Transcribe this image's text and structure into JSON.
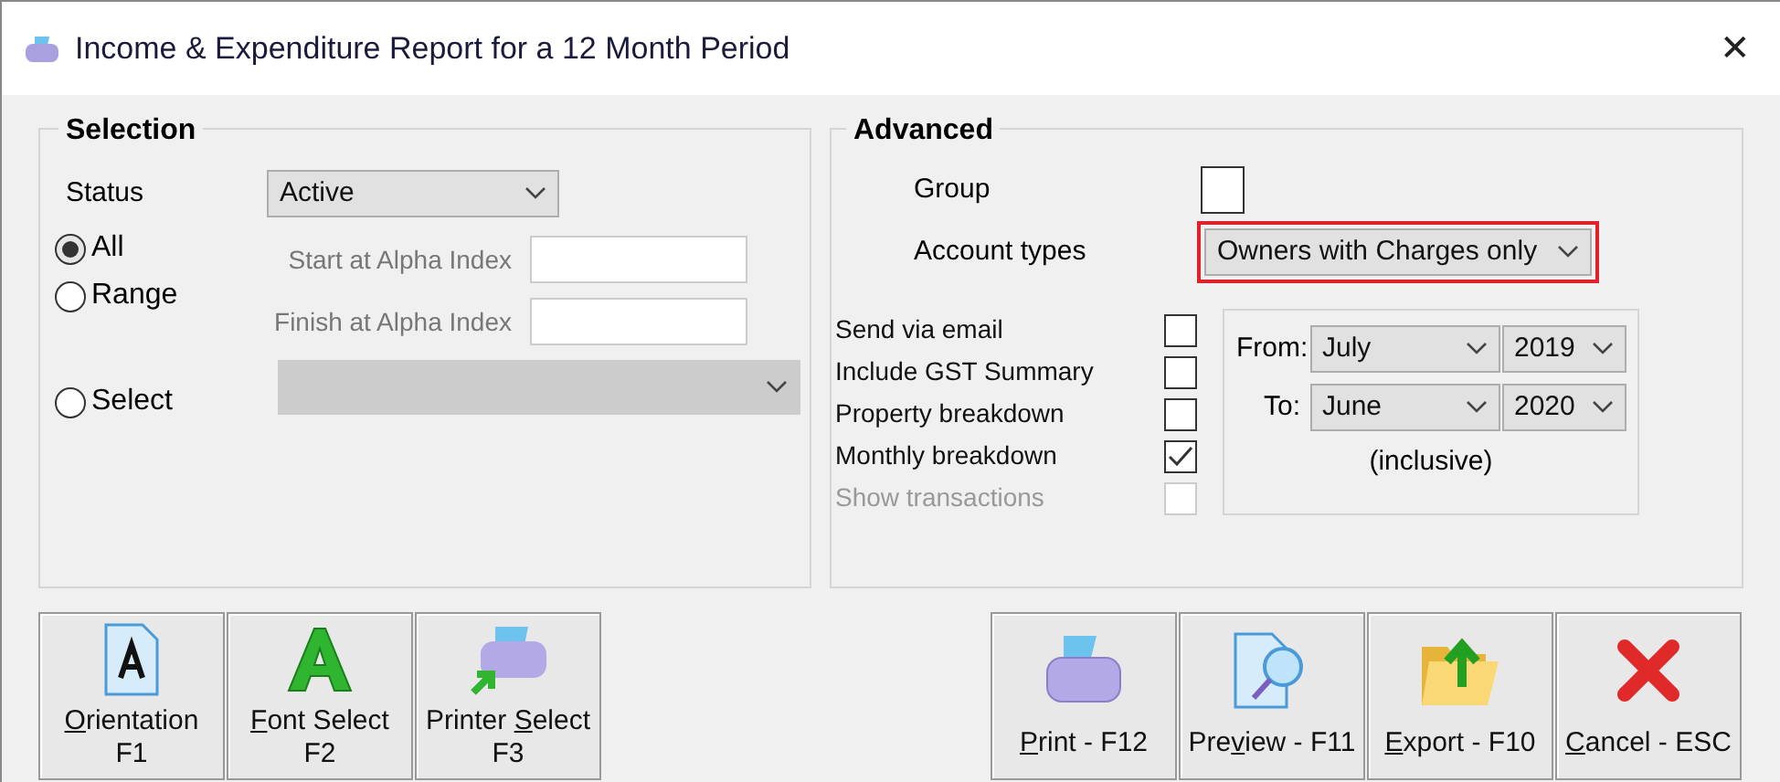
{
  "window": {
    "title": "Income & Expenditure Report for a 12 Month Period",
    "close": "✕"
  },
  "selection": {
    "title": "Selection",
    "status_label": "Status",
    "status_value": "Active",
    "radios": [
      {
        "label": "All",
        "selected": true
      },
      {
        "label": "Range",
        "selected": false
      },
      {
        "label": "Select",
        "selected": false
      }
    ],
    "start_label": "Start at Alpha Index",
    "finish_label": "Finish at Alpha Index"
  },
  "advanced": {
    "title": "Advanced",
    "group_label": "Group",
    "group_checked": false,
    "account_types_label": "Account types",
    "account_types_value": "Owners with Charges only",
    "options": [
      {
        "label": "Send via email",
        "checked": false,
        "disabled": false
      },
      {
        "label": "Include GST Summary",
        "checked": false,
        "disabled": false
      },
      {
        "label": "Property breakdown",
        "checked": false,
        "disabled": false
      },
      {
        "label": "Monthly breakdown",
        "checked": true,
        "disabled": false
      },
      {
        "label": "Show transactions",
        "checked": false,
        "disabled": true
      }
    ],
    "from_label": "From:",
    "from_month": "July",
    "from_year": "2019",
    "to_label": "To:",
    "to_month": "June",
    "to_year": "2020",
    "inclusive": "(inclusive)"
  },
  "left_buttons": [
    {
      "kind": "orientation",
      "key": "O",
      "post": "rientation",
      "shortcut": "F1"
    },
    {
      "kind": "font",
      "key": "F",
      "post": "ont Select",
      "shortcut": "F2"
    },
    {
      "kind": "printer_select",
      "pre": "Printer ",
      "key": "S",
      "post": "elect",
      "shortcut": "F3"
    }
  ],
  "right_buttons": [
    {
      "kind": "print",
      "key": "P",
      "post": "rint - F12"
    },
    {
      "kind": "preview",
      "pre": "Pre",
      "key": "v",
      "post": "iew - F11"
    },
    {
      "kind": "export",
      "key": "E",
      "post": "xport - F10"
    },
    {
      "kind": "cancel",
      "key": "C",
      "post": "ancel - ESC"
    }
  ]
}
